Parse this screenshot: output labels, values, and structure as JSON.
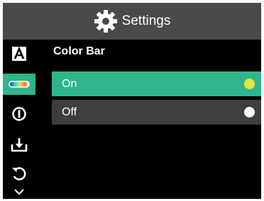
{
  "header": {
    "title": "Settings",
    "icon": "gear-icon"
  },
  "sidebar": {
    "items": [
      {
        "icon": "font-a-icon",
        "active": false
      },
      {
        "icon": "color-bar-icon",
        "active": true
      },
      {
        "icon": "info-icon",
        "active": false
      },
      {
        "icon": "download-tray-icon",
        "active": false
      },
      {
        "icon": "reset-icon",
        "active": false
      },
      {
        "icon": "chevron-down-icon",
        "active": false
      }
    ]
  },
  "section": {
    "title": "Color Bar"
  },
  "options": [
    {
      "label": "On",
      "selected": true,
      "dot_color": "#e4e43a"
    },
    {
      "label": "Off",
      "selected": false,
      "dot_color": "#ffffff"
    }
  ],
  "colors": {
    "accent": "#2fb58e",
    "header": "#4a4a4a",
    "background": "#000000"
  }
}
